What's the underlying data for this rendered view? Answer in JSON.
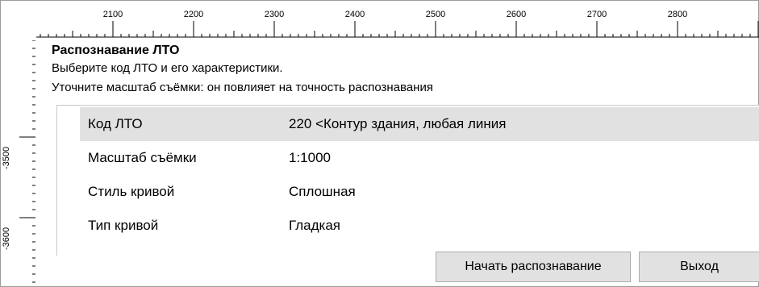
{
  "rulers": {
    "horizontal": [
      "2100",
      "2200",
      "2300",
      "2400",
      "2500",
      "2600",
      "2700",
      "2800"
    ],
    "vertical": [
      "-3500",
      "-3600"
    ]
  },
  "panel": {
    "title": "Распознавание ЛТО",
    "line1": "Выберите код ЛТО и его характеристики.",
    "line2": "Уточните масштаб съёмки: он повлияет на точность распознавания"
  },
  "properties": [
    {
      "key": "Код ЛТО",
      "value": "220 <Контур здания, любая линия",
      "selected": true
    },
    {
      "key": "Масштаб съёмки",
      "value": "1:1000",
      "selected": false
    },
    {
      "key": "Стиль кривой",
      "value": "Сплошная",
      "selected": false
    },
    {
      "key": "Тип кривой",
      "value": "Гладкая",
      "selected": false
    }
  ],
  "buttons": {
    "start": "Начать распознавание",
    "exit": "Выход"
  }
}
